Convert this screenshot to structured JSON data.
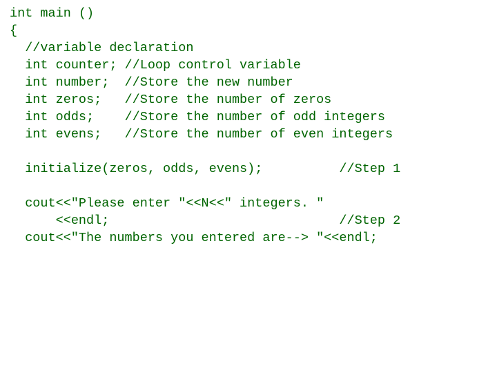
{
  "code": {
    "l1": "int main ()",
    "l2": "{",
    "l3": "  //variable declaration",
    "l4": "  int counter; //Loop control variable",
    "l5": "  int number;  //Store the new number",
    "l6": "  int zeros;   //Store the number of zeros",
    "l7": "  int odds;    //Store the number of odd integers",
    "l8": "  int evens;   //Store the number of even integers",
    "l9": "",
    "l10": "  initialize(zeros, odds, evens);          //Step 1",
    "l11": "",
    "l12": "  cout<<\"Please enter \"<<N<<\" integers. \"",
    "l13": "      <<endl;                              //Step 2",
    "l14": "  cout<<\"The numbers you entered are--> \"<<endl;"
  }
}
